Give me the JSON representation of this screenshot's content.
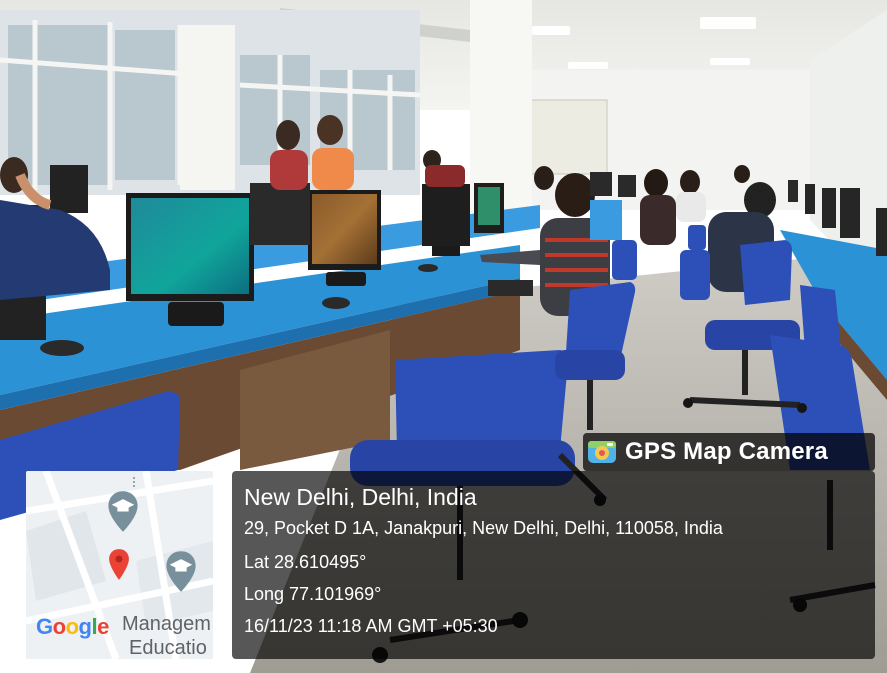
{
  "overlay": {
    "app_name": "GPS Map Camera",
    "location_title": "New Delhi, Delhi, India",
    "address": "29, Pocket D 1A, Janakpuri, New Delhi, Delhi, 110058, India",
    "latitude": "Lat 28.610495°",
    "longitude": "Long 77.101969°",
    "datetime": "16/11/23 11:18 AM GMT +05:30"
  },
  "map": {
    "poi_label_line1": "Managem",
    "poi_label_line2": "Educatio",
    "google_logo_text": "Google",
    "google_colors": [
      "#4285F4",
      "#EA4335",
      "#FBBC05",
      "#4285F4",
      "#34A853",
      "#EA4335"
    ],
    "pin_color": "#EA4335",
    "poi_icon_color": "#78909C",
    "school_icon": "school-icon"
  },
  "colors": {
    "desk": "#2f95d8",
    "chair": "#2d4fb8",
    "wall": "#f2f3f1",
    "floor": "#b9b6ad",
    "panel_bg": "rgba(0,0,0,0.66)"
  }
}
